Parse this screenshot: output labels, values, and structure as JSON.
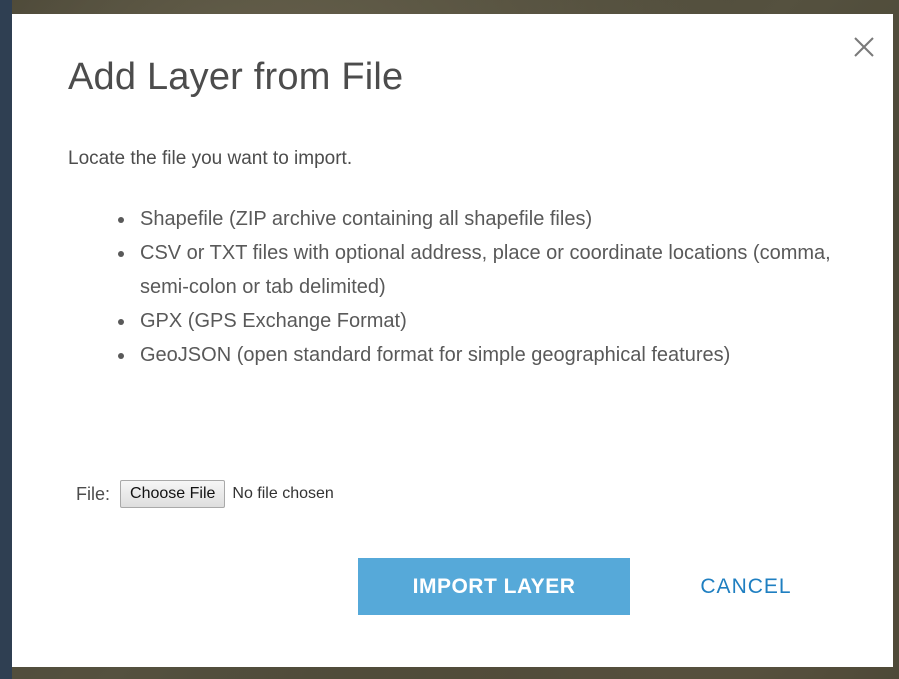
{
  "dialog": {
    "title": "Add Layer from File",
    "close_icon": "close-icon",
    "intro": "Locate the file you want to import.",
    "formats": [
      "Shapefile (ZIP archive containing all shapefile files)",
      "CSV or TXT files with optional address, place or coordinate locations (comma, semi-colon or tab delimited)",
      "GPX (GPS Exchange Format)",
      "GeoJSON (open standard format for simple geographical features)"
    ],
    "file": {
      "label": "File:",
      "choose_button": "Choose File",
      "status": "No file chosen"
    },
    "import_button": "IMPORT LAYER",
    "cancel_button": "CANCEL"
  },
  "colors": {
    "primary_button": "#56a9d9",
    "cancel_text": "#1f7fc1",
    "title_text": "#4c4c4c"
  }
}
